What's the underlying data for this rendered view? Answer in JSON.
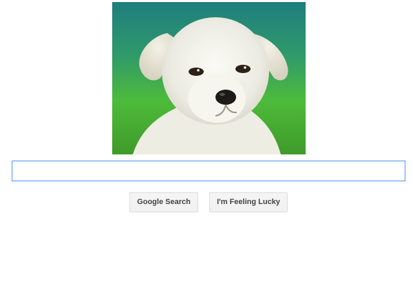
{
  "logo": {
    "icon": "puppy-photo"
  },
  "search": {
    "value": "",
    "placeholder": ""
  },
  "buttons": {
    "search_label": "Google Search",
    "lucky_label": "I'm Feeling Lucky"
  },
  "colors": {
    "input_border": "#4d90fe",
    "button_bg": "#f2f2f2",
    "button_border": "#dcdcdc",
    "button_text": "#444444"
  }
}
